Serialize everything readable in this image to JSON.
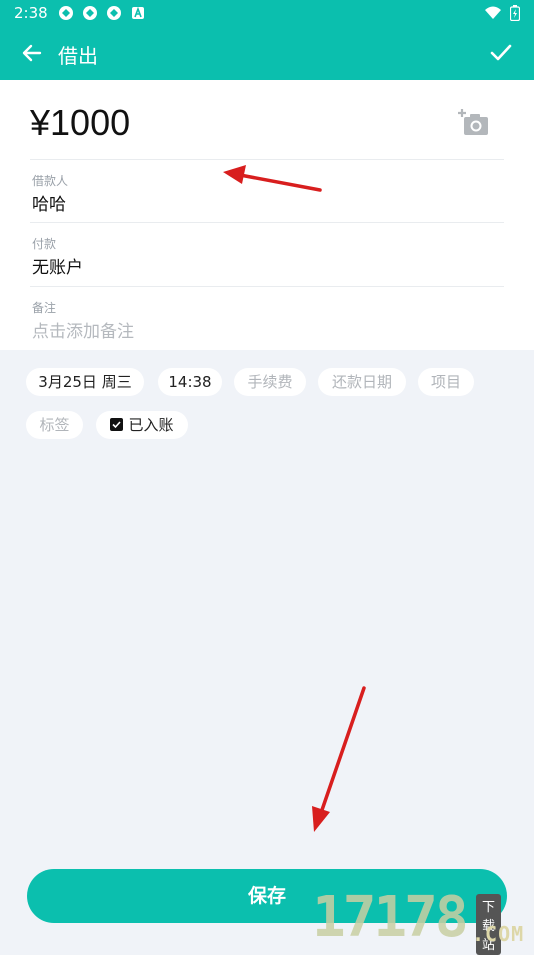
{
  "status_bar": {
    "time": "2:38"
  },
  "toolbar": {
    "title": "借出"
  },
  "form": {
    "amount": "¥1000",
    "borrower": {
      "label": "借款人",
      "value": "哈哈"
    },
    "payment": {
      "label": "付款",
      "value": "无账户"
    },
    "note": {
      "label": "备注",
      "placeholder": "点击添加备注"
    }
  },
  "chips": {
    "date": "3月25日  周三",
    "time": "14:38",
    "fee": "手续费",
    "repay_date": "还款日期",
    "project": "项目",
    "tag": "标签",
    "recorded": "已入账"
  },
  "save_label": "保存",
  "watermark": {
    "number": "17178",
    "tag": "下载站",
    "suffix": ".COM"
  },
  "colors": {
    "accent": "#0bbfae",
    "background": "#f0f3f8",
    "annotation_arrow": "#d81e1e"
  }
}
